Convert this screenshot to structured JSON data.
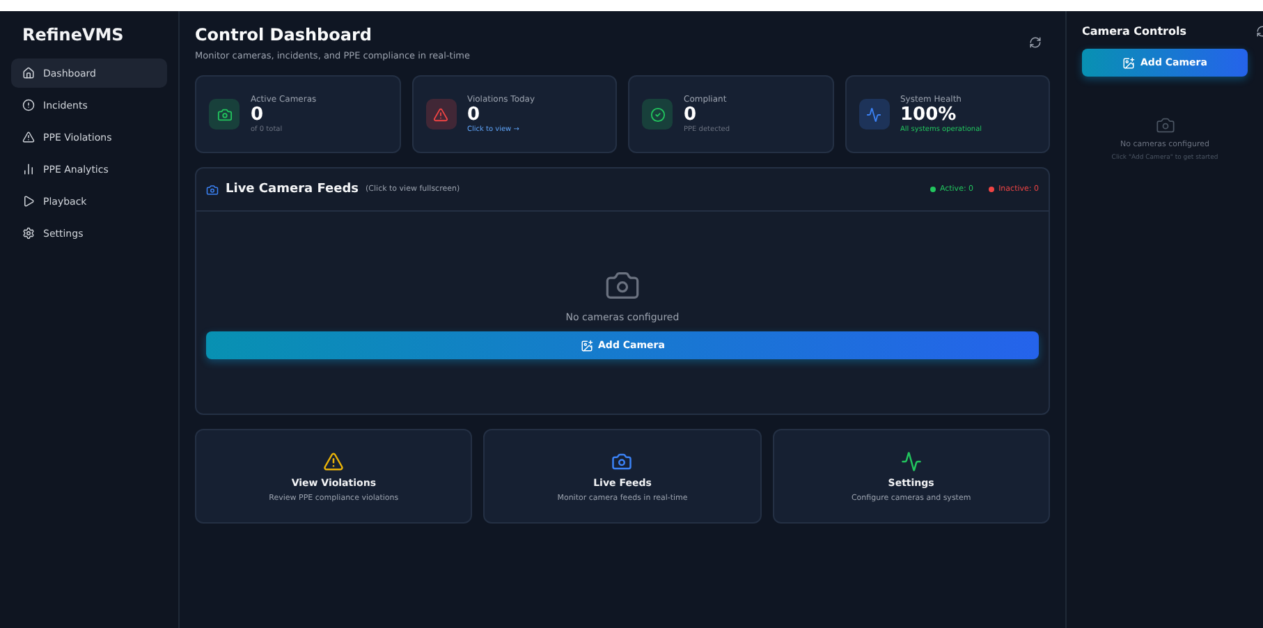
{
  "sidebar": {
    "brand": "RefineVMS",
    "items": [
      {
        "label": "Dashboard",
        "selected": true
      },
      {
        "label": "Incidents",
        "selected": false
      },
      {
        "label": "PPE Violations",
        "selected": false
      },
      {
        "label": "PPE Analytics",
        "selected": false
      },
      {
        "label": "Playback",
        "selected": false
      },
      {
        "label": "Settings",
        "selected": false
      }
    ]
  },
  "header": {
    "title": "Control Dashboard",
    "subtitle": "Monitor cameras, incidents, and PPE compliance in real-time"
  },
  "stats": [
    {
      "label": "Active Cameras",
      "value": "0",
      "note": "of 0 total",
      "color": "#22c55e",
      "kind": "muted"
    },
    {
      "label": "Violations Today",
      "value": "0",
      "note": "Click to view →",
      "color": "#ef4444",
      "kind": "link"
    },
    {
      "label": "Compliant",
      "value": "0",
      "note": "PPE detected",
      "color": "#22c55e",
      "kind": "muted"
    },
    {
      "label": "System Health",
      "value": "100%",
      "note": "All systems operational",
      "color": "#3b82f6",
      "kind": "good"
    }
  ],
  "feeds": {
    "title": "Live Camera Feeds",
    "hint": "(Click to view fullscreen)",
    "active": "Active: 0",
    "inactive": "Inactive: 0",
    "empty": "No cameras configured",
    "button": "Add Camera"
  },
  "quick": [
    {
      "title": "View Violations",
      "desc": "Review PPE compliance violations",
      "color": "#eab308"
    },
    {
      "title": "Live Feeds",
      "desc": "Monitor camera feeds in real-time",
      "color": "#3b82f6"
    },
    {
      "title": "Settings",
      "desc": "Configure cameras and system",
      "color": "#22c55e"
    }
  ],
  "panel": {
    "title": "Camera Controls",
    "button": "Add Camera",
    "empty": "No cameras configured",
    "hint": "Click \"Add Camera\" to get started"
  }
}
